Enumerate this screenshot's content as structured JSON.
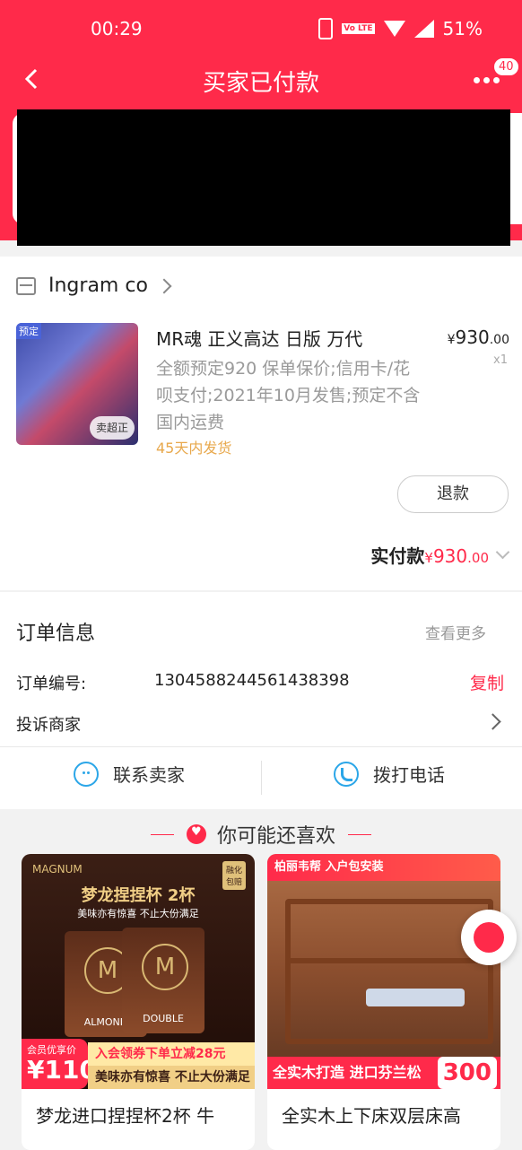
{
  "status_bar": {
    "time": "00:29",
    "battery": "51%",
    "network": "4G",
    "volte": "Vo LTE"
  },
  "nav": {
    "title": "买家已付款",
    "badge": "40"
  },
  "shop": {
    "name": "Ingram co"
  },
  "product": {
    "tag": "预定",
    "corner": "卖超正",
    "name": "MR魂 正义高达 日版 万代",
    "desc": "全额预定920 保单保价;信用卡/花呗支付;2021年10月发售;预定不含国内运费",
    "ship": "45天内发货",
    "price_symbol": "¥",
    "price_int": "930",
    "price_dec": ".00",
    "qty": "x1"
  },
  "refund_label": "退款",
  "paid": {
    "label": "实付款",
    "symbol": "¥",
    "int": "930",
    "dec": ".00"
  },
  "order_info": {
    "title": "订单信息",
    "see_more": "查看更多",
    "order_no_label": "订单编号:",
    "order_no": "1304588244561438398",
    "copy": "复制",
    "complain": "投诉商家"
  },
  "contact": {
    "seller": "联系卖家",
    "phone": "拨打电话"
  },
  "recommend": {
    "title": "你可能还喜欢",
    "items": [
      {
        "name": "梦龙进口捏捏杯2杯 牛",
        "brand": "MAGNUM",
        "headline": "梦龙捏捏杯 2杯",
        "sub": "美味亦有惊喜 不止大份满足",
        "cup1": "ALMOND",
        "cup2": "DOUBLE",
        "badge": "融化包赔",
        "vip_small": "会员优享价",
        "vip_price": "¥110",
        "strip1": "入会领券下单立减28元",
        "strip2": "美味亦有惊喜 不止大份满足"
      },
      {
        "name": "全实木上下床双层床高",
        "top": "柏丽韦帮 入户包安装",
        "bottom": "全实木打造 进口芬兰松",
        "price": "300"
      }
    ]
  }
}
